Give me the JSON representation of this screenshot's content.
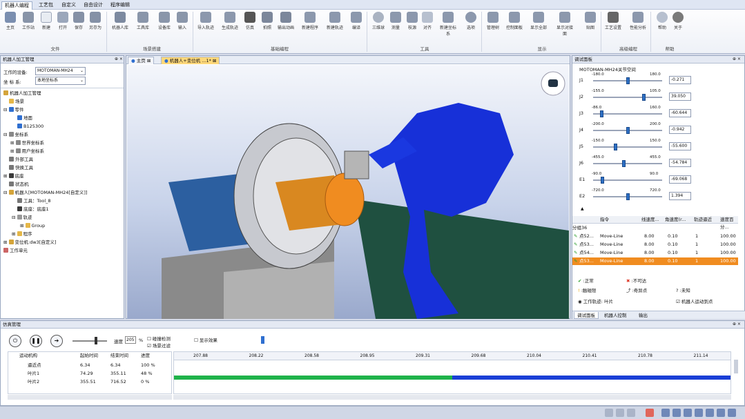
{
  "menu": {
    "tabs": [
      "机器人编程",
      "工艺包",
      "自定义",
      "自由设计",
      "程序编辑"
    ]
  },
  "ribbon": {
    "buttons": [
      "主页",
      "工作站",
      "新建",
      "打开",
      "保存",
      "另存为",
      "机器人库",
      "工具库",
      "设备库",
      "输入",
      "导入轨迹",
      "生成轨迹",
      "仿真",
      "拍照",
      "输出动画",
      "新建程序",
      "新建轨迹",
      "编译",
      "三维球",
      "测量",
      "枝源",
      "对齐",
      "新建坐标系",
      "选项",
      "管理树",
      "控制面板",
      "显示全部",
      "显示对接面",
      "贴图",
      "工艺设置",
      "性能分析",
      "帮助",
      "关于"
    ],
    "groups": [
      "文件",
      "场景搭建",
      "基础编程",
      "工具",
      "显示",
      "高级编程",
      "帮助"
    ]
  },
  "left_panel": {
    "title": "机器人加工管理",
    "device_label": "工作的设备:",
    "device_value": "MOTOMAN-MH24",
    "coord_label": "坐 标 系:",
    "coord_value": "本地坐标系",
    "tree": [
      "机器人加工管理",
      "场景",
      "零件",
      "地面",
      "B125300",
      "坐标系",
      "世界坐标系",
      "用户坐标系",
      "外部工具",
      "快换工具",
      "底座",
      "状态机",
      "机器人[MOTOMAN-MH24[自定义]]",
      "工具：Tool_8",
      "底座：底座1",
      "轨迹",
      "Group",
      "程序",
      "变位机:dw3[自定义]",
      "工作单元"
    ]
  },
  "doc_tabs": [
    "主页",
    "机器人+变位机 ...1*"
  ],
  "right_panel": {
    "title": "调试面板",
    "joint_title": "MOTOMAN-MH24关节空间",
    "joints": [
      {
        "name": "J1",
        "min": "-180.0",
        "max": "180.0",
        "value": "-0.271",
        "pos": 0.5
      },
      {
        "name": "J2",
        "min": "-155.0",
        "max": "105.0",
        "value": "39.050",
        "pos": 0.75
      },
      {
        "name": "J3",
        "min": "-86.0",
        "max": "160.0",
        "value": "-60.644",
        "pos": 0.1
      },
      {
        "name": "J4",
        "min": "-200.0",
        "max": "200.0",
        "value": "-0.942",
        "pos": 0.5
      },
      {
        "name": "J5",
        "min": "-150.0",
        "max": "150.0",
        "value": "-55.600",
        "pos": 0.32
      },
      {
        "name": "J6",
        "min": "-455.0",
        "max": "455.0",
        "value": "-54.784",
        "pos": 0.44
      },
      {
        "name": "E1",
        "min": "-90.0",
        "max": "90.0",
        "value": "-69.068",
        "pos": 0.12
      },
      {
        "name": "E2",
        "min": "-720.0",
        "max": "720.0",
        "value": "1.394",
        "pos": 0.5
      }
    ],
    "cmd_headers": [
      "",
      "指令",
      "线速度...",
      "角速度(r...",
      "轨迹逼近",
      "速度百分..."
    ],
    "group_label": "分组36",
    "cmd_rows": [
      {
        "name": "点52...",
        "cmd": "Move-Line",
        "lin": "8.00",
        "ang": "0.10",
        "approach": "1",
        "pct": "100.00",
        "selected": false
      },
      {
        "name": "点53...",
        "cmd": "Move-Line",
        "lin": "8.00",
        "ang": "0.10",
        "approach": "1",
        "pct": "100.00",
        "selected": false
      },
      {
        "name": "点54...",
        "cmd": "Move-Line",
        "lin": "8.00",
        "ang": "0.10",
        "approach": "1",
        "pct": "100.00",
        "selected": false
      },
      {
        "name": "点53...",
        "cmd": "Move-Line",
        "lin": "8.00",
        "ang": "0.10",
        "approach": "1",
        "pct": "100.00",
        "selected": true
      }
    ],
    "legend": {
      "normal": ":正常",
      "unreachable": ":不可达",
      "collision": ":触碰限",
      "singular": ":奇异点",
      "unknown": ":未知",
      "track_label": "工作轨迹:",
      "track_value": "叶片",
      "robot_move": "机器人运动到点"
    },
    "tabs": [
      "调试面板",
      "机器人控制",
      "输出"
    ]
  },
  "sim": {
    "title": "仿真管理",
    "speed_label": "速度",
    "speed_value": "205",
    "percent": "%",
    "collision_check": "碰撞检测",
    "scene_follow": "场景过滤",
    "show_effect": "显示效果",
    "headers": [
      "运动机构",
      "起始时间",
      "结束时间",
      "进度"
    ],
    "rows": [
      {
        "name": "逼近点",
        "start": "6.34",
        "end": "6.34",
        "progress": "100 %"
      },
      {
        "name": "叶片1",
        "start": "74.29",
        "end": "355.11",
        "progress": "48 %"
      },
      {
        "name": "叶片2",
        "start": "355.51",
        "end": "716.52",
        "progress": "0 %"
      }
    ],
    "ticks": [
      "207.88",
      "208.22",
      "208.58",
      "208.95",
      "209.31",
      "209.68",
      "210.04",
      "210.41",
      "210.78",
      "211.14"
    ],
    "progress_fraction": 0.5
  }
}
